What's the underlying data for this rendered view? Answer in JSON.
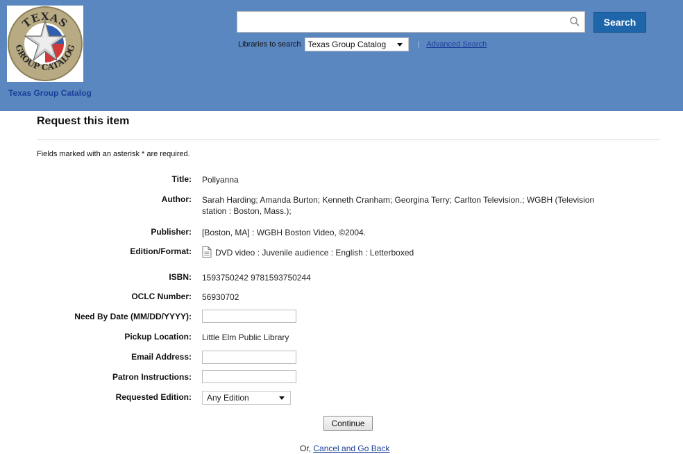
{
  "header": {
    "site_name": "Texas Group Catalog",
    "logo": {
      "text_top": "TEXAS",
      "text_bottom": "GROUP CATALOG"
    },
    "search": {
      "query": "",
      "button_label": "Search",
      "libraries_label": "Libraries to search",
      "libraries_selected": "Texas Group Catalog",
      "separator": "|",
      "advanced_link": "Advanced Search"
    }
  },
  "main": {
    "title": "Request this item",
    "required_note": "Fields marked with an asterisk * are required.",
    "fields": {
      "title": {
        "label": "Title:",
        "value": "Pollyanna"
      },
      "author": {
        "label": "Author:",
        "value_line1": "Sarah Harding; Amanda Burton; Kenneth Cranham; Georgina Terry; Carlton Television.; WGBH (Television",
        "value_line2": "station : Boston, Mass.);"
      },
      "publisher": {
        "label": "Publisher:",
        "value": "[Boston, MA] : WGBH Boston Video, ©2004."
      },
      "edition": {
        "label": "Edition/Format:",
        "value": "DVD video : Juvenile audience : English : Letterboxed"
      },
      "isbn": {
        "label": "ISBN:",
        "value": "1593750242 9781593750244"
      },
      "oclc": {
        "label": "OCLC Number:",
        "value": "56930702"
      },
      "need_by": {
        "label": "Need By Date (MM/DD/YYYY):",
        "value": ""
      },
      "pickup": {
        "label": "Pickup Location:",
        "value": "Little Elm Public Library"
      },
      "email": {
        "label": "Email Address:",
        "value": ""
      },
      "instructions": {
        "label": "Patron Instructions:",
        "value": ""
      },
      "requested_edition": {
        "label": "Requested Edition:",
        "selected": "Any Edition"
      }
    },
    "continue_label": "Continue",
    "cancel_prefix": "Or,",
    "cancel_link": "Cancel and Go Back"
  },
  "colors": {
    "header_bg": "#5b87c0",
    "link": "#1b3f9a",
    "search_button": "#1e65aa"
  }
}
